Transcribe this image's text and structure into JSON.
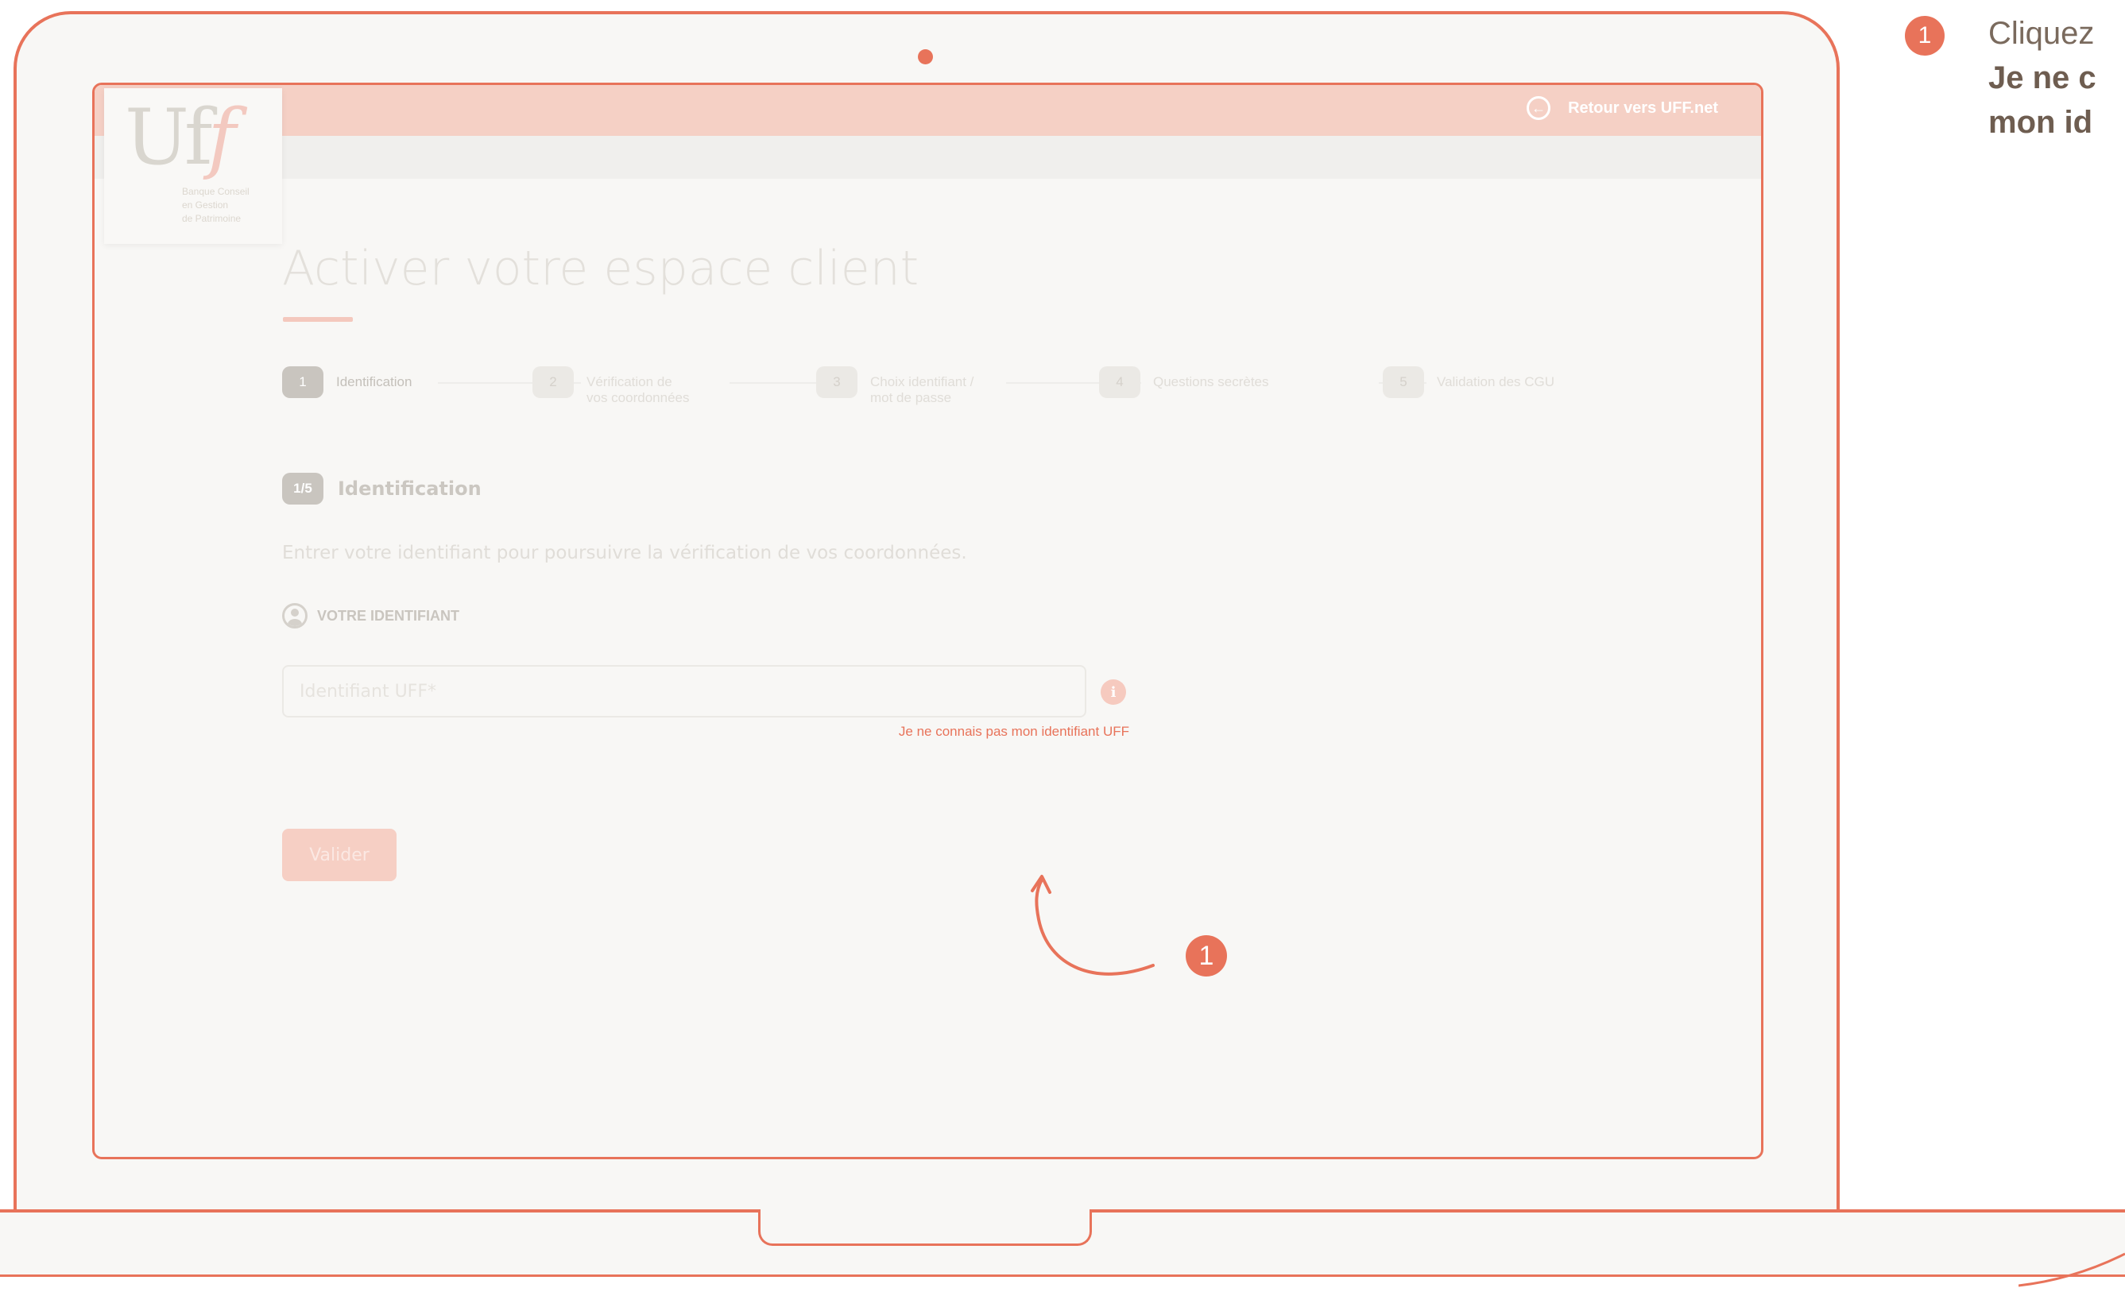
{
  "header": {
    "back_link_label": "Retour vers UFF.net"
  },
  "logo": {
    "mark_uf": "Uf",
    "mark_ff": "f",
    "tagline": "Banque Conseil\nen Gestion\nde Patrimoine"
  },
  "page": {
    "title": "Activer votre espace client"
  },
  "stepper": {
    "steps": [
      {
        "num": "1",
        "label": "Identification"
      },
      {
        "num": "2",
        "label": "Vérification de\nvos coordonnées"
      },
      {
        "num": "3",
        "label": "Choix identifiant /\nmot de passe"
      },
      {
        "num": "4",
        "label": "Questions secrètes"
      },
      {
        "num": "5",
        "label": "Validation des CGU"
      }
    ]
  },
  "section": {
    "badge": "1/5",
    "title": "Identification",
    "intro": "Entrer votre identifiant pour poursuivre la vérification de vos coordonnées.",
    "field_label": "VOTRE IDENTIFIANT",
    "input_placeholder": "Identifiant UFF*",
    "input_value": "",
    "info_icon_glyph": "i",
    "forgot_link": "Je ne connais pas mon identifiant UFF",
    "submit_label": "Valider"
  },
  "annotation": {
    "badge": "1"
  },
  "instructions": {
    "badge": "1",
    "line1": "Cliquez",
    "line2": "Je ne c",
    "line3": "mon id"
  },
  "colors": {
    "accent": "#e8735a",
    "header_bg": "#f5d0c5"
  }
}
